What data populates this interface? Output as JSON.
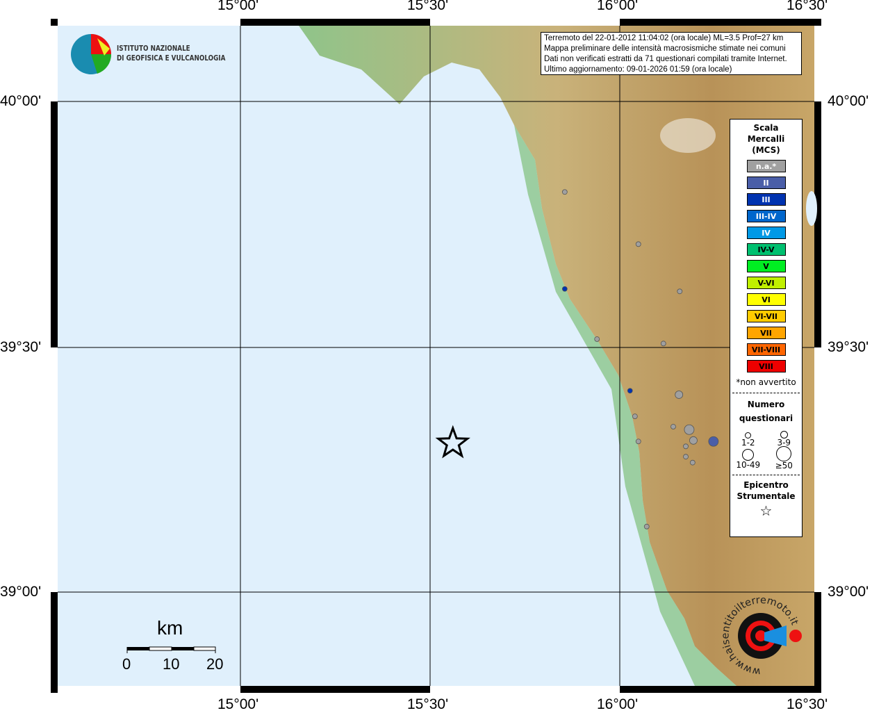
{
  "ticks": {
    "lon": [
      "15°00'",
      "15°30'",
      "16°00'",
      "16°30'"
    ],
    "lat": [
      "40°00'",
      "39°30'",
      "39°00'"
    ]
  },
  "logo": {
    "line1": "ISTITUTO NAZIONALE",
    "line2": "DI GEOFISICA E VULCANOLOGIA"
  },
  "info": [
    "Terremoto del 22-01-2012 11:04:02 (ora locale) ML=3.5 Prof=27 km",
    "Mappa preliminare delle intensità macrosismiche stimate nei comuni",
    "Dati non verificati estratti da 71 questionari compilati tramite Internet.",
    "Ultimo aggiornamento: 09-01-2026 01:59 (ora locale)"
  ],
  "legend": {
    "title": [
      "Scala",
      "Mercalli",
      "(MCS)"
    ],
    "classes": [
      {
        "label": "n.a.*",
        "color": "#a0a0a0",
        "text": "#ffffff"
      },
      {
        "label": "II",
        "color": "#4a5ea8",
        "text": "#ffffff"
      },
      {
        "label": "III",
        "color": "#0033b0",
        "text": "#ffffff"
      },
      {
        "label": "III-IV",
        "color": "#0066cc",
        "text": "#ffffff"
      },
      {
        "label": "IV",
        "color": "#0099e6",
        "text": "#ffffff"
      },
      {
        "label": "IV-V",
        "color": "#00c070",
        "text": "#000000"
      },
      {
        "label": "V",
        "color": "#00ee22",
        "text": "#000000"
      },
      {
        "label": "V-VI",
        "color": "#c0f000",
        "text": "#000000"
      },
      {
        "label": "VI",
        "color": "#ffff00",
        "text": "#000000"
      },
      {
        "label": "VI-VII",
        "color": "#ffcc00",
        "text": "#000000"
      },
      {
        "label": "VII",
        "color": "#ffa500",
        "text": "#000000"
      },
      {
        "label": "VII-VIII",
        "color": "#ff6600",
        "text": "#000000"
      },
      {
        "label": "VIII",
        "color": "#ee0000",
        "text": "#000000"
      }
    ],
    "note": "*non avvertito",
    "count_title": [
      "Numero",
      "questionari"
    ],
    "sizes": [
      "1-2",
      "3-9",
      "10-49",
      "≥50"
    ],
    "epi_title": [
      "Epicentro",
      "Strumentale"
    ]
  },
  "scale": {
    "unit": "km",
    "labels": [
      "0",
      "10",
      "20"
    ]
  },
  "brand": {
    "text": "www.haisentitoilterremoto.it"
  },
  "epicenter": {
    "lon": 15.56,
    "lat": 39.305
  },
  "points": [
    {
      "lon": 15.855,
      "lat": 39.816,
      "cls": "n.a.*",
      "size": "1-2"
    },
    {
      "lon": 16.049,
      "lat": 39.71,
      "cls": "n.a.*",
      "size": "1-2"
    },
    {
      "lon": 16.158,
      "lat": 39.614,
      "cls": "n.a.*",
      "size": "1-2"
    },
    {
      "lon": 15.855,
      "lat": 39.619,
      "cls": "III",
      "size": "1-2"
    },
    {
      "lon": 15.94,
      "lat": 39.517,
      "cls": "n.a.*",
      "size": "1-2"
    },
    {
      "lon": 16.115,
      "lat": 39.508,
      "cls": "n.a.*",
      "size": "1-2"
    },
    {
      "lon": 16.027,
      "lat": 39.412,
      "cls": "III",
      "size": "1-2"
    },
    {
      "lon": 16.156,
      "lat": 39.404,
      "cls": "n.a.*",
      "size": "3-9"
    },
    {
      "lon": 16.04,
      "lat": 39.36,
      "cls": "n.a.*",
      "size": "1-2"
    },
    {
      "lon": 16.141,
      "lat": 39.339,
      "cls": "n.a.*",
      "size": "1-2"
    },
    {
      "lon": 16.183,
      "lat": 39.333,
      "cls": "n.a.*",
      "size": "10-49"
    },
    {
      "lon": 16.194,
      "lat": 39.311,
      "cls": "n.a.*",
      "size": "3-9"
    },
    {
      "lon": 16.247,
      "lat": 39.309,
      "cls": "II",
      "size": "10-49"
    },
    {
      "lon": 16.049,
      "lat": 39.309,
      "cls": "n.a.*",
      "size": "1-2"
    },
    {
      "lon": 16.174,
      "lat": 39.299,
      "cls": "n.a.*",
      "size": "1-2"
    },
    {
      "lon": 16.174,
      "lat": 39.278,
      "cls": "n.a.*",
      "size": "1-2"
    },
    {
      "lon": 16.192,
      "lat": 39.266,
      "cls": "n.a.*",
      "size": "1-2"
    },
    {
      "lon": 16.071,
      "lat": 39.136,
      "cls": "n.a.*",
      "size": "1-2"
    }
  ]
}
